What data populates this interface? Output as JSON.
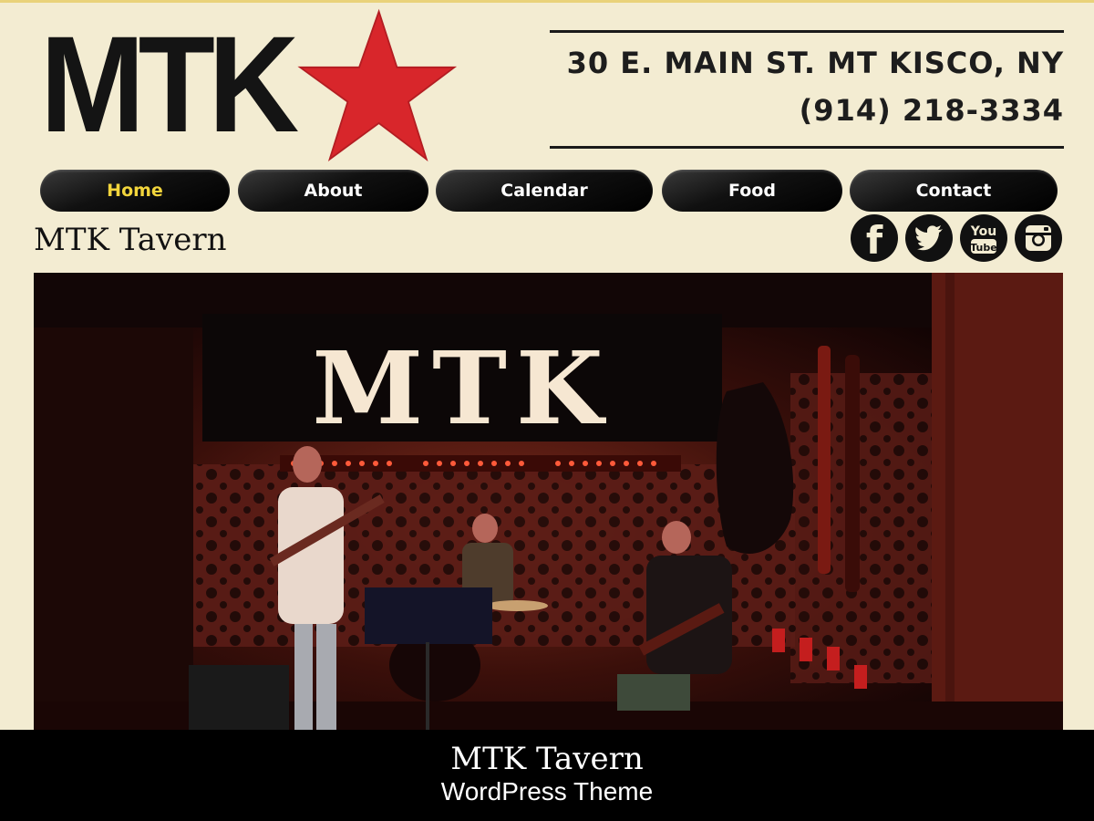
{
  "logo": {
    "text": "MTK",
    "star_icon": "red-star-icon"
  },
  "address": {
    "street": "30 E. MAIN ST. MT KISCO, NY",
    "phone": "(914) 218-3334"
  },
  "nav": {
    "items": [
      {
        "label": "Home",
        "active": true
      },
      {
        "label": "About",
        "active": false
      },
      {
        "label": "Calendar",
        "active": false
      },
      {
        "label": "Food",
        "active": false
      },
      {
        "label": "Contact",
        "active": false
      }
    ],
    "active_color": "#f2d53c"
  },
  "page": {
    "title": "MTK Tavern"
  },
  "social": [
    {
      "icon": "facebook-icon"
    },
    {
      "icon": "twitter-icon"
    },
    {
      "icon": "youtube-icon",
      "text": "You Tube"
    },
    {
      "icon": "instagram-icon"
    }
  ],
  "hero": {
    "sign_text": "MTK"
  },
  "caption": {
    "title": "MTK Tavern",
    "subtitle": "WordPress Theme"
  },
  "colors": {
    "background": "#f3ecd2",
    "accent_red": "#d8262b",
    "nav_dark": "#111111"
  }
}
